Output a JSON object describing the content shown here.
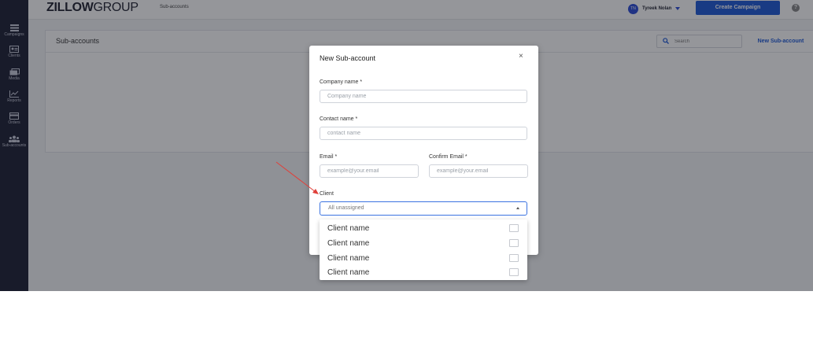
{
  "app": {
    "logo_bold": "ZILLOW",
    "logo_thin": "GROUP",
    "breadcrumb": "Sub-accounts"
  },
  "sidebar": {
    "items": [
      {
        "label": "Campaigns",
        "icon": "list-icon"
      },
      {
        "label": "Clients",
        "icon": "id-card-icon"
      },
      {
        "label": "Media",
        "icon": "images-icon"
      },
      {
        "label": "Reports",
        "icon": "chart-icon"
      },
      {
        "label": "Orders",
        "icon": "card-icon"
      },
      {
        "label": "Sub-accounts",
        "icon": "users-icon"
      }
    ]
  },
  "header": {
    "avatar_initials": "TN",
    "user_name": "Tyreek Nolan",
    "create_campaign": "Create Campaign",
    "help": "?"
  },
  "page": {
    "title": "Sub-accounts",
    "search_placeholder": "Search",
    "new_sub_account": "New Sub-account"
  },
  "modal": {
    "title": "New Sub-account",
    "close": "×",
    "company_label": "Company name *",
    "company_placeholder": "Company name",
    "contact_label": "Contact name *",
    "contact_placeholder": "contact name",
    "email_label": "Email *",
    "email_placeholder": "example@your.email",
    "confirm_email_label": "Confirm Email *",
    "confirm_email_placeholder": "example@your.email",
    "client_label": "Client",
    "client_value": "All unassigned"
  },
  "dropdown": {
    "options": [
      {
        "label": "Client name",
        "checked": false
      },
      {
        "label": "Client name",
        "checked": false
      },
      {
        "label": "Client name",
        "checked": false
      },
      {
        "label": "Client name",
        "checked": false
      }
    ]
  },
  "colors": {
    "sidebar": "#1c1f33",
    "accent": "#1e5ad8",
    "annotation_arrow": "#e0403a"
  }
}
